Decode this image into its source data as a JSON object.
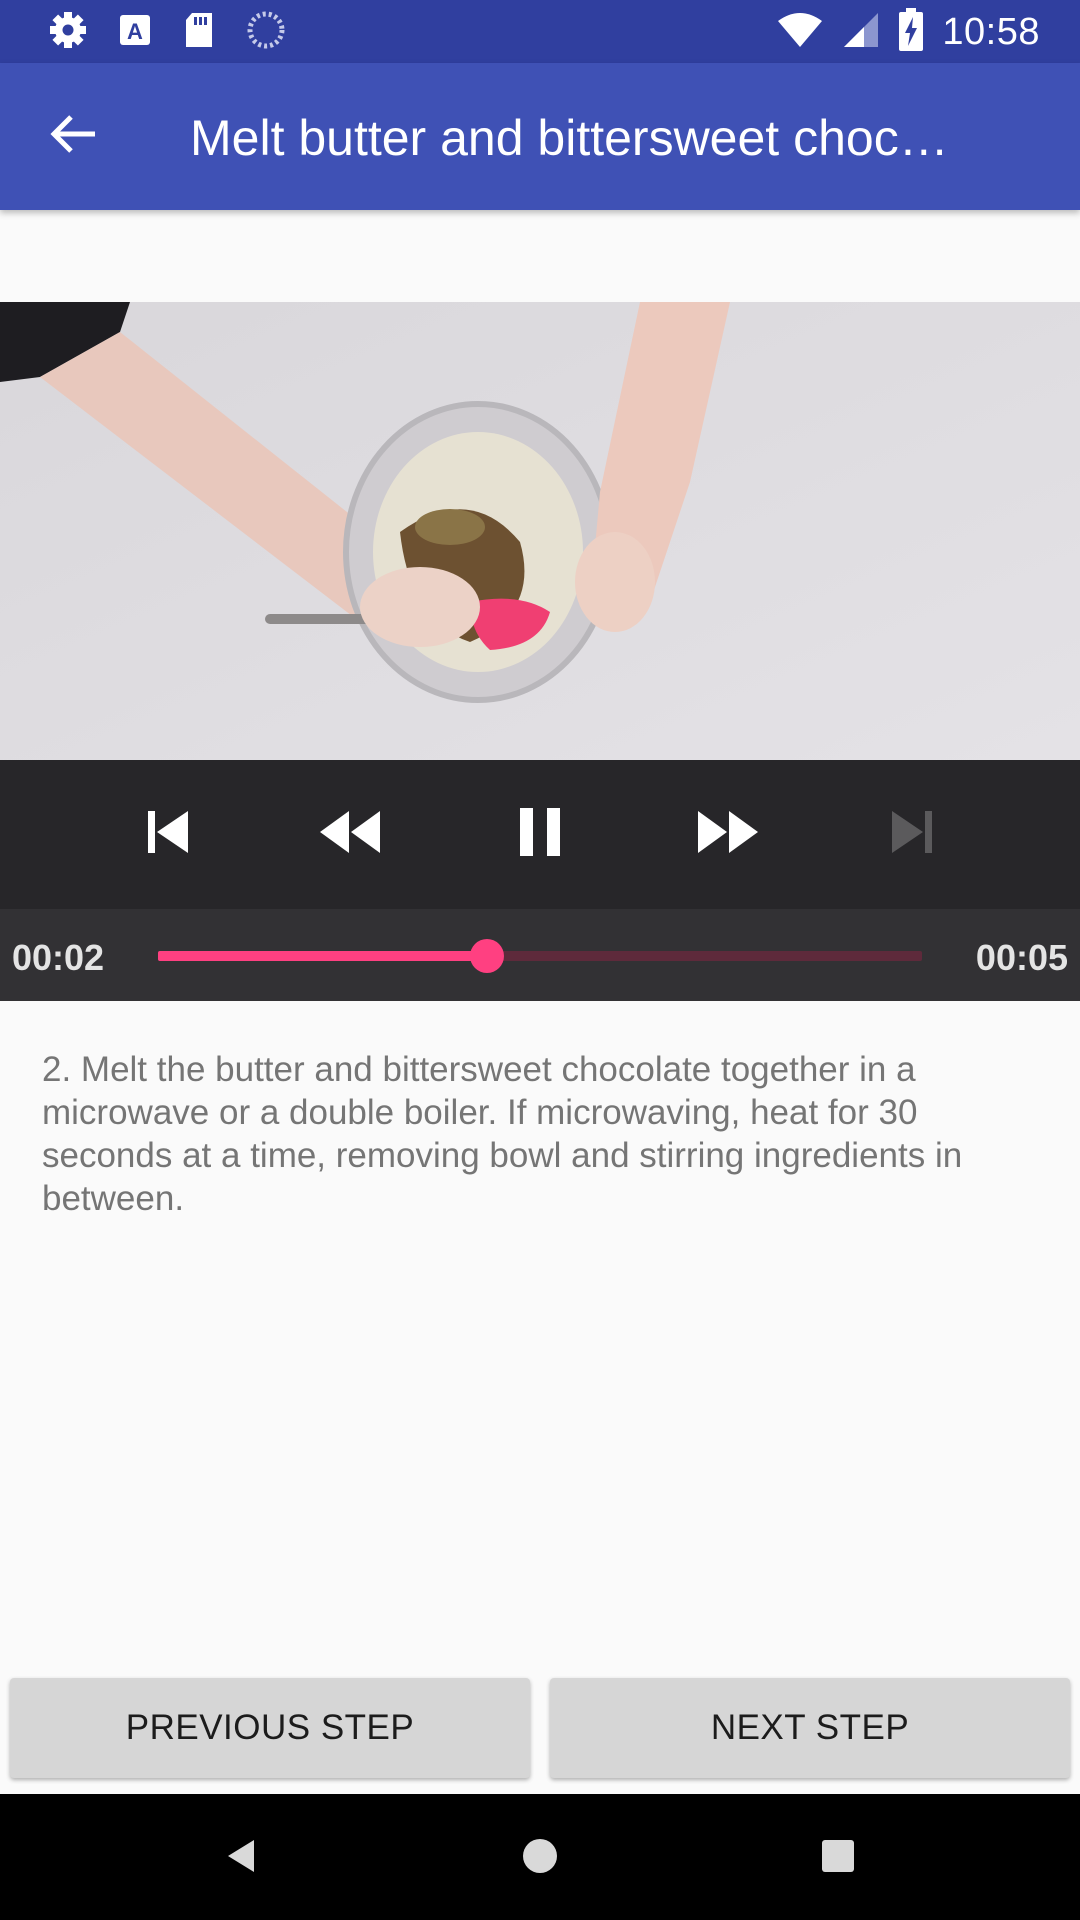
{
  "status_bar": {
    "time": "10:58",
    "left_icons": [
      "gear-icon",
      "font-a-icon",
      "sd-card-icon",
      "loading-spinner-icon"
    ],
    "right_icons": [
      "wifi-icon",
      "cell-signal-icon",
      "battery-charging-icon"
    ]
  },
  "app_bar": {
    "back_icon": "arrow-left-icon",
    "title": "Melt butter and bittersweet choc…"
  },
  "player": {
    "position": "00:02",
    "duration": "00:05",
    "progress_fraction": 0.43,
    "accent_color": "#ff4081",
    "controls": [
      "skip-previous-icon",
      "rewind-icon",
      "pause-icon",
      "fast-forward-icon",
      "skip-next-icon"
    ],
    "skip_next_enabled": false
  },
  "step": {
    "description": "2. Melt the butter and bittersweet chocolate together in a microwave or a double boiler. If microwaving, heat for 30 seconds at a time, removing bowl and stirring ingredients in between."
  },
  "buttons": {
    "previous_label": "PREVIOUS STEP",
    "next_label": "NEXT STEP"
  },
  "colors": {
    "status_bar": "#303f9f",
    "app_bar": "#3f51b5",
    "controls_bg": "#272629"
  },
  "nav_bar": {
    "icons": [
      "back-triangle-icon",
      "home-circle-icon",
      "recents-square-icon"
    ]
  }
}
